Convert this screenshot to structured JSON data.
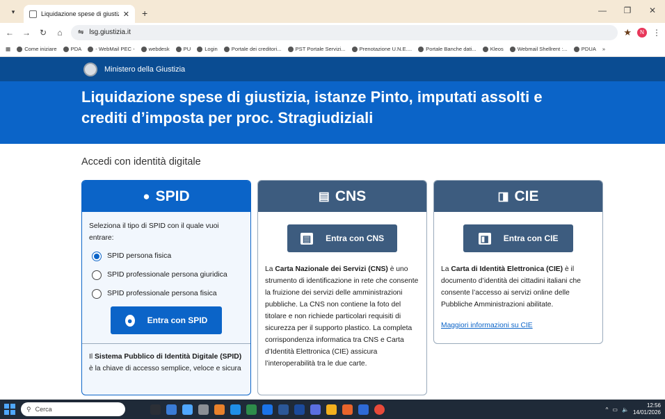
{
  "browser": {
    "tab_title": "Liquidazione spese di giustizia",
    "url": "lsg.giustizia.it",
    "profile_initial": "N",
    "bookmarks": [
      "Come iniziare",
      "PDA",
      "- WebMail PEC -",
      "webdesk",
      "PU",
      "Login",
      "Portale dei creditori...",
      "PST Portale Servizi...",
      "Prenotazione U.N.E....",
      "Portale Banche dati...",
      "Kleos",
      "Webmail Shellrent :...",
      "PDUA"
    ],
    "more": "»"
  },
  "header": {
    "ministry": "Ministero della Giustizia",
    "title_line1": "Liquidazione spese di giustizia, istanze Pinto, imputati assolti e",
    "title_line2": "crediti d’imposta per proc. Stragiudiziali"
  },
  "main": {
    "section_title": "Accedi con identità digitale",
    "spid": {
      "title": "SPID",
      "intro": "Seleziona il tipo di SPID con il quale vuoi entrare:",
      "options": [
        "SPID persona fisica",
        "SPID professionale persona giuridica",
        "SPID professionale persona fisica"
      ],
      "button": "Entra con SPID",
      "desc_bold": "Sistema Pubblico di Identità Digitale (SPID)",
      "desc_pre": "Il ",
      "desc_post": " è la chiave di accesso semplice, veloce e sicura"
    },
    "cns": {
      "title": "CNS",
      "button": "Entra con CNS",
      "desc_pre": "La ",
      "desc_bold": "Carta Nazionale dei Servizi (CNS)",
      "desc_post": " è uno strumento di identificazione in rete che consente la fruizione dei servizi delle amministrazioni pubbliche. La CNS non contiene la foto del titolare e non richiede particolari requisiti di sicurezza per il supporto plastico. La completa corrispondenza informatica tra CNS e Carta d’Identità Elettronica (CIE) assicura l’interoperabilità tra le due carte."
    },
    "cie": {
      "title": "CIE",
      "button": "Entra con CIE",
      "desc_pre": "La ",
      "desc_bold": "Carta di Identità Elettronica (CIE)",
      "desc_post": " è il documento d’identità dei cittadini italiani che consente l’accesso ai servizi online delle Pubbliche Amministrazioni abilitate.",
      "link": "Maggiori informazioni su CIE"
    }
  },
  "taskbar": {
    "search": "Cerca",
    "time": "12:56",
    "date": "14/01/2026"
  }
}
